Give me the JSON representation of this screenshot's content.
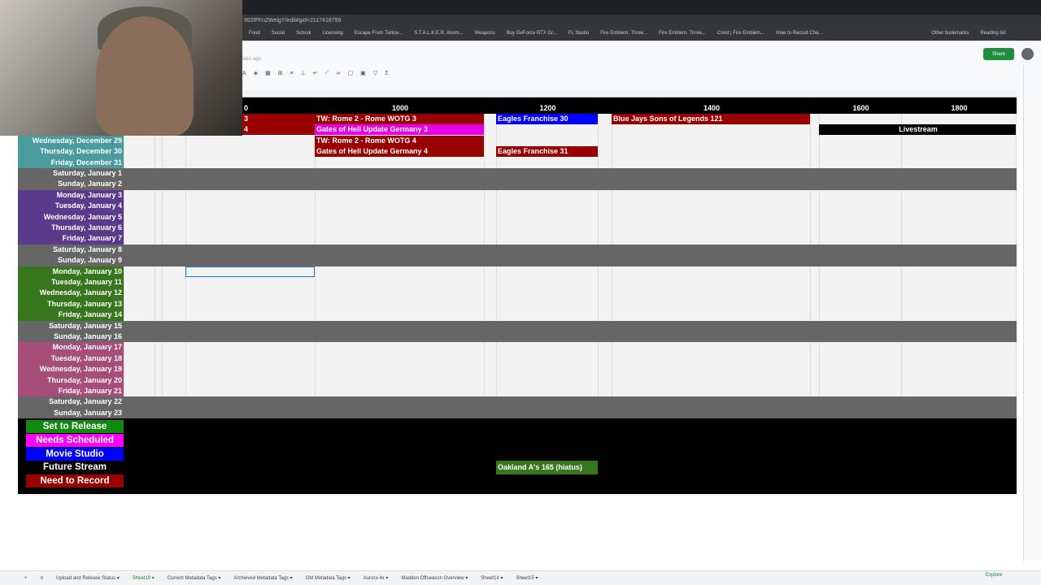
{
  "browser": {
    "url": "992lPFn2WelgY/edit#gid=2117416799",
    "bookmarks": [
      "Food",
      "Social",
      "School",
      "Licensing",
      "Escape From Tarkov...",
      "S.T.A.L.K.E.R. Anom...",
      "Weapons",
      "Buy GeForce RTX Gr...",
      "FL Studio",
      "Fire Emblem: Three...",
      "Fire Emblem: Three...",
      "Crest | Fire Emblem...",
      "How to Recruit Cha...",
      "Other bookmarks",
      "Reading list"
    ]
  },
  "app": {
    "saved_status": "utes ago",
    "share_label": "Share",
    "toolbar_icons": [
      "text-color",
      "fill-color",
      "borders",
      "merge",
      "align",
      "valign",
      "wrap",
      "rotate",
      "link",
      "comment",
      "chart",
      "filter",
      "functions"
    ]
  },
  "header_row": {
    "labels": [
      {
        "col": "F",
        "text": "0"
      },
      {
        "col": "G",
        "text": "1000"
      },
      {
        "col": "I",
        "text": "1200"
      },
      {
        "col": "K",
        "text": "1400"
      },
      {
        "col": "M",
        "text": "1600"
      },
      {
        "col": "N",
        "text": "1800"
      }
    ]
  },
  "dates": [
    {
      "row": 2,
      "label": "Wednesday, December 29",
      "color": "#4a9b9b"
    },
    {
      "row": 3,
      "label": "Thursday, December 30",
      "color": "#4a9b9b"
    },
    {
      "row": 4,
      "label": "Friday, December 31",
      "color": "#4a9b9b"
    },
    {
      "row": 5,
      "label": "Saturday, January 1",
      "color": "#666666",
      "weekend": true
    },
    {
      "row": 6,
      "label": "Sunday, January 2",
      "color": "#666666",
      "weekend": true
    },
    {
      "row": 7,
      "label": "Monday, January 3",
      "color": "#5b3a8c"
    },
    {
      "row": 8,
      "label": "Tuesday, January 4",
      "color": "#5b3a8c"
    },
    {
      "row": 9,
      "label": "Wednesday, January 5",
      "color": "#5b3a8c"
    },
    {
      "row": 10,
      "label": "Thursday, January 6",
      "color": "#5b3a8c"
    },
    {
      "row": 11,
      "label": "Friday, January 7",
      "color": "#5b3a8c"
    },
    {
      "row": 12,
      "label": "Saturday, January 8",
      "color": "#666666",
      "weekend": true
    },
    {
      "row": 13,
      "label": "Sunday, January 9",
      "color": "#666666",
      "weekend": true
    },
    {
      "row": 14,
      "label": "Monday, January 10",
      "color": "#38761d"
    },
    {
      "row": 15,
      "label": "Tuesday, January 11",
      "color": "#38761d"
    },
    {
      "row": 16,
      "label": "Wednesday, January 12",
      "color": "#38761d"
    },
    {
      "row": 17,
      "label": "Thursday, January 13",
      "color": "#38761d"
    },
    {
      "row": 18,
      "label": "Friday, January 14",
      "color": "#38761d"
    },
    {
      "row": 19,
      "label": "Saturday, January 15",
      "color": "#666666",
      "weekend": true
    },
    {
      "row": 20,
      "label": "Sunday, January 16",
      "color": "#666666",
      "weekend": true
    },
    {
      "row": 21,
      "label": "Monday, January 17",
      "color": "#a64d79"
    },
    {
      "row": 22,
      "label": "Tuesday, January 18",
      "color": "#a64d79"
    },
    {
      "row": 23,
      "label": "Wednesday, January 19",
      "color": "#a64d79"
    },
    {
      "row": 24,
      "label": "Thursday, January 20",
      "color": "#a64d79"
    },
    {
      "row": 25,
      "label": "Friday, January 21",
      "color": "#a64d79"
    },
    {
      "row": 26,
      "label": "Saturday, January 22",
      "color": "#666666",
      "weekend": true
    },
    {
      "row": 27,
      "label": "Sunday, January 23",
      "color": "#666666",
      "weekend": true
    }
  ],
  "events": [
    {
      "row": 0,
      "col": "F",
      "text": "3",
      "color": "#990000"
    },
    {
      "row": 0,
      "col": "G",
      "text": "TW: Rome 2 - Rome WOTG 3",
      "color": "#990000"
    },
    {
      "row": 0,
      "col": "I",
      "text": "Eagles Franchise 30",
      "color": "#0000ff"
    },
    {
      "row": 0,
      "col": "K",
      "text": "Blue Jays Sons of Legends 121",
      "color": "#990000"
    },
    {
      "row": 1,
      "col": "F",
      "text": "4",
      "color": "#990000"
    },
    {
      "row": 1,
      "col": "G",
      "text": "Gates of Hell Update Germany 3",
      "color": "#e600e6"
    },
    {
      "row": 1,
      "col": "MN",
      "text": "Livestream",
      "color": "#000000",
      "center": true
    },
    {
      "row": 2,
      "col": "G",
      "text": "TW: Rome 2 - Rome WOTG 4",
      "color": "#990000"
    },
    {
      "row": 3,
      "col": "G",
      "text": "Gates of Hell Update Germany 4",
      "color": "#990000"
    },
    {
      "row": 3,
      "col": "I",
      "text": "Eagles Franchise 31",
      "color": "#990000"
    }
  ],
  "legend": [
    {
      "label": "Set to Release",
      "bg": "#0f8a0f",
      "fg": "#ffffff"
    },
    {
      "label": "Needs Scheduled",
      "bg": "#ff00ff",
      "fg": "#ffffff"
    },
    {
      "label": "Movie Studio",
      "bg": "#0000ff",
      "fg": "#ffffff"
    },
    {
      "label": "Future Stream",
      "bg": "#000000",
      "fg": "#ffffff"
    },
    {
      "label": "Need to Record",
      "bg": "#990000",
      "fg": "#ffffff"
    }
  ],
  "legend_event": {
    "text": "Oakland A's 165 (hiatus)",
    "color": "#38761d"
  },
  "sheet_tabs": [
    "Upload and Release Status",
    "Sheet10",
    "Current Metadata Tags",
    "Archieved Metadata Tags",
    "Old Metadata Tags",
    "Aurora 4x",
    "Madden Offseason Overview",
    "Sheet14",
    "Sheet15"
  ],
  "active_tab": "Sheet10",
  "explore_label": "Explore"
}
